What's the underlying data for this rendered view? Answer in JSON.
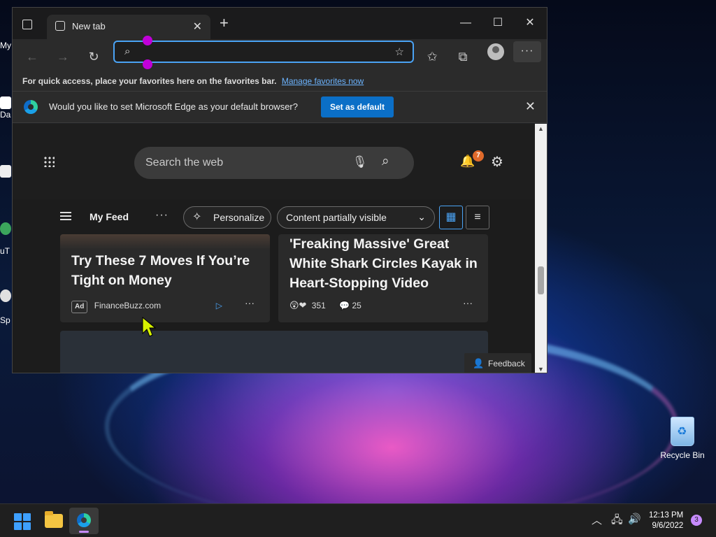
{
  "desktop": {
    "left_labels": [
      "My",
      "Da",
      "uT",
      "Sp"
    ],
    "recycle_bin": "Recycle Bin"
  },
  "browser": {
    "tab_title": "New tab",
    "address": {
      "value": "",
      "placeholder": ""
    },
    "favbar": {
      "text": "For quick access, place your favorites here on the favorites bar.",
      "link": "Manage favorites now"
    },
    "infobar": {
      "text": "Would you like to set Microsoft Edge as your default browser?",
      "button": "Set as default"
    },
    "new_tab_page": {
      "search_placeholder": "Search the web",
      "notifications_count": "7",
      "feed": {
        "title": "My Feed",
        "personalize": "Personalize",
        "content_visibility": "Content partially visible"
      },
      "cards": [
        {
          "title": "Try These 7 Moves If You’re Tight on Money",
          "ad": "Ad",
          "source": "FinanceBuzz.com"
        },
        {
          "title": "'Freaking Massive' Great White Shark Circles Kayak in Heart-Stopping Video",
          "reactions": "351",
          "comments": "25"
        }
      ],
      "feedback": "Feedback"
    }
  },
  "taskbar": {
    "time": "12:13 PM",
    "date": "9/6/2022",
    "notifications": "3"
  },
  "colors": {
    "accent": "#4aa3f5",
    "set_default_button": "#0b6fc7",
    "badge": "#e06a2b"
  }
}
